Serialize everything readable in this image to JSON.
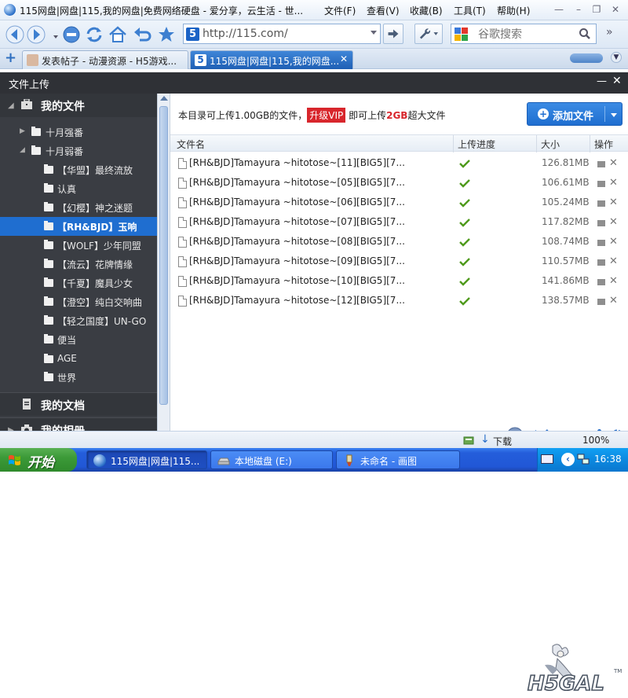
{
  "browser": {
    "window_title": "115网盘|网盘|115,我的网盘|免费网络硬盘 - 爱分享，云生活 - 世...",
    "menu": [
      "文件(F)",
      "查看(V)",
      "收藏(B)",
      "工具(T)",
      "帮助(H)"
    ],
    "address": "http://115.com/",
    "search_placeholder": "谷歌搜索",
    "tabs": [
      {
        "label": "发表帖子 - 动漫资源 - H5游戏..."
      },
      {
        "label": "115网盘|网盘|115,我的网盘..."
      }
    ]
  },
  "panel": {
    "title": "文件上传",
    "quota_prefix": "本目录可上传1.00GB的文件，",
    "vip": "升级VIP",
    "quota_mid": " 即可上传",
    "quota_size": "2GB",
    "quota_suffix": "超大文件",
    "add_file": "添加文件",
    "columns": {
      "name": "文件名",
      "progress": "上传进度",
      "size": "大小",
      "action": "操作"
    }
  },
  "sidebar": {
    "my_files": "我的文件",
    "folders": [
      {
        "label": "十月强番"
      },
      {
        "label": "十月弱番"
      },
      {
        "label": "【华盟】最终流放"
      },
      {
        "label": "认真"
      },
      {
        "label": "【幻樱】神之迷题"
      },
      {
        "label": "【RH&BJD】玉响"
      },
      {
        "label": "【WOLF】少年同盟"
      },
      {
        "label": "【流云】花牌情缘"
      },
      {
        "label": "【千夏】魔具少女"
      },
      {
        "label": "【澄空】纯白交响曲"
      },
      {
        "label": "【轻之国度】UN-GO"
      },
      {
        "label": "便当"
      },
      {
        "label": "AGE"
      },
      {
        "label": "世界"
      }
    ],
    "my_docs": "我的文档",
    "my_album": "我的相册"
  },
  "files": [
    {
      "name": "[RH&BJD]Tamayura ~hitotose~[11][BIG5][7...",
      "size": "126.81MB"
    },
    {
      "name": "[RH&BJD]Tamayura ~hitotose~[05][BIG5][7...",
      "size": "106.61MB"
    },
    {
      "name": "[RH&BJD]Tamayura ~hitotose~[06][BIG5][7...",
      "size": "105.24MB"
    },
    {
      "name": "[RH&BJD]Tamayura ~hitotose~[07][BIG5][7...",
      "size": "117.82MB"
    },
    {
      "name": "[RH&BJD]Tamayura ~hitotose~[08][BIG5][7...",
      "size": "108.74MB"
    },
    {
      "name": "[RH&BJD]Tamayura ~hitotose~[09][BIG5][7...",
      "size": "110.57MB"
    },
    {
      "name": "[RH&BJD]Tamayura ~hitotose~[10][BIG5][7...",
      "size": "141.86MB"
    },
    {
      "name": "[RH&BJD]Tamayura ~hitotose~[12][BIG5][7...",
      "size": "138.57MB"
    }
  ],
  "status": {
    "download": "下载",
    "zoom": "100%"
  },
  "taskbar": {
    "start": "开始",
    "tasks": [
      {
        "label": "115网盘|网盘|115..."
      },
      {
        "label": "本地磁盘 (E:)"
      },
      {
        "label": "未命名 - 画图"
      }
    ],
    "clock": "16:38"
  },
  "watermark": "H5GAL",
  "colors": {
    "accent": "#1f6ed0",
    "vip": "#d8262c",
    "check": "#4f9a1c",
    "sidebar": "#3a3d43"
  }
}
